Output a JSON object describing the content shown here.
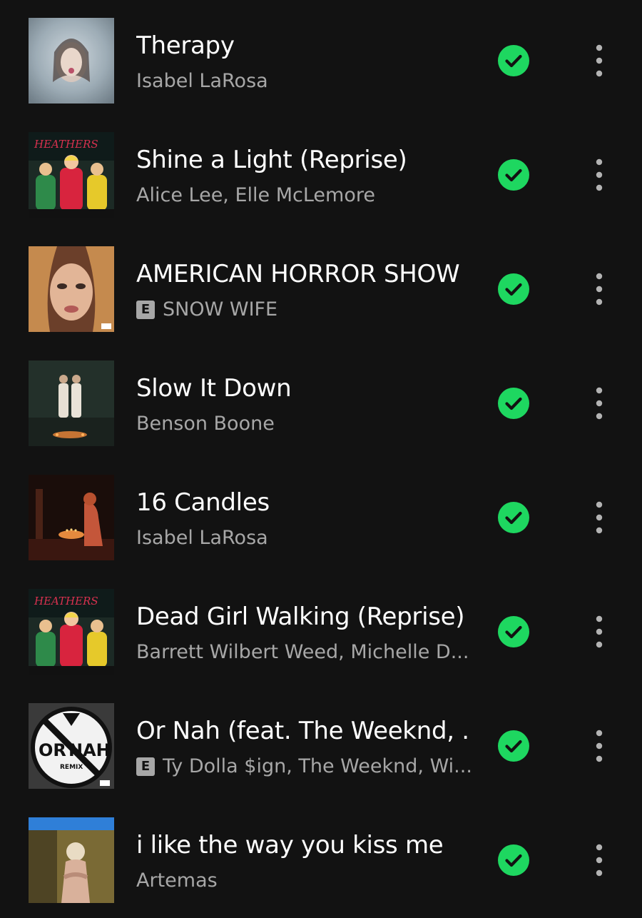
{
  "accent_color": "#1ed760",
  "tracks": [
    {
      "title": "Therapy",
      "artist": "Isabel LaRosa",
      "explicit": false,
      "cover": "therapy"
    },
    {
      "title": "Shine a Light (Reprise)",
      "artist": "Alice Lee, Elle McLemore",
      "explicit": false,
      "cover": "heathers"
    },
    {
      "title": "AMERICAN HORROR SHOW",
      "artist": "SNOW WIFE",
      "explicit": true,
      "cover": "american-horror-show"
    },
    {
      "title": "Slow It Down",
      "artist": "Benson Boone",
      "explicit": false,
      "cover": "slow-it-down"
    },
    {
      "title": "16 Candles",
      "artist": "Isabel LaRosa",
      "explicit": false,
      "cover": "candles"
    },
    {
      "title": "Dead Girl Walking (Reprise)",
      "artist": "Barrett Wilbert Weed, Michelle D...",
      "explicit": false,
      "cover": "heathers"
    },
    {
      "title": "Or Nah (feat. The Weeknd, ...",
      "artist": "Ty Dolla $ign, The Weeknd, Wi...",
      "explicit": true,
      "cover": "or-nah"
    },
    {
      "title": "i like the way you kiss me",
      "artist": "Artemas",
      "explicit": false,
      "cover": "kiss-me"
    }
  ],
  "explicit_label": "E",
  "cover_text": {
    "heathers_logo": "HEATHERS",
    "or_nah_line1": "OR",
    "or_nah_line2": "NAH",
    "or_nah_remix": "REMIX"
  },
  "icons": {
    "downloaded": "check-circle-icon",
    "more": "more-vertical-icon"
  }
}
